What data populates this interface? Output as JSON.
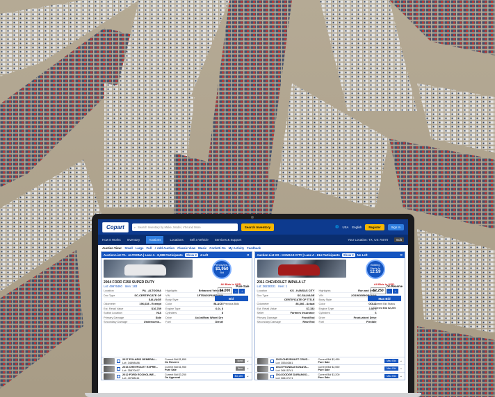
{
  "header": {
    "logo": "Copart",
    "search_placeholder": "Search Inventory by Make, Model, VIN and More",
    "search_button": "Search Inventory",
    "country": "USA",
    "language": "English",
    "register": "Register",
    "sign_in": "Sign In"
  },
  "nav": {
    "items": [
      "How It Works",
      "Inventory",
      "Auctions",
      "Locations",
      "Sell a Vehicle",
      "Services & Support"
    ],
    "active_index": 2,
    "location": "Your Location: TX, US 75070",
    "edit": "Edit"
  },
  "modes": {
    "label": "Auction View:",
    "items": [
      "Small",
      "Large",
      "Full",
      "+ Add Auction",
      "Classic View",
      "Music",
      "Confetti On",
      "My Activity",
      "Feedback"
    ]
  },
  "panel_left": {
    "title": "Auction List  PA - ALTOONA | Lane A - 8,388 Participants",
    "badge": "Show 2",
    "left_count": "4 Left",
    "vehicle": "2004 FORD F250 SUPER DUTY",
    "lot": "Lot: 49976460",
    "item": "Item: 183",
    "sale": "Pure Sale",
    "bid_circle_top": "Pennsylva...",
    "bid_circle_amount": "$1,950",
    "bid_circle_bottom": "Bid",
    "bids_note": "All Bids in USD.",
    "amount": "$4,000",
    "bid_button": "Bid",
    "prev_bids": "Previous Bids",
    "rows": [
      [
        "Location",
        "PA - ALTOONA",
        "Highlights",
        "Enhanced Vehicles"
      ],
      [
        "Doc Type",
        "SC-CERTIFICATE OF",
        "VIN",
        "1FTSW21P64ED*****"
      ],
      [
        "",
        "SALVAGE",
        "Body Style",
        "N/A"
      ],
      [
        "Odometer",
        "196,638 - Exempt",
        "Color",
        "BLACK"
      ],
      [
        "Est. Retail Value",
        "$16,789",
        "Engine Type",
        "6.0L 8"
      ],
      [
        "Sublot Location",
        "N/A",
        "Cylinders",
        "8"
      ],
      [
        "Primary Damage",
        "Side",
        "Drive",
        "4x4 w/Rear Wheel Drv"
      ],
      [
        "Secondary Damage",
        "Undercarria...",
        "Fuel",
        "Diesel"
      ]
    ],
    "list": [
      {
        "name": "2017 POLARIS GENERAL...",
        "lot": "Lot: 34898486",
        "status": "On Reserve",
        "bid": "Current Bid $1,850",
        "button": "Next"
      },
      {
        "name": "2016 CHEVROLET EXPRE...",
        "lot": "Lot: 35870497",
        "status": "Pure Sale",
        "bid": "Current Bid $1,950",
        "button": "Item"
      },
      {
        "name": "2012 FORD ECONOLINE...",
        "lot": "Lot: 40788411",
        "status": "On Approval",
        "bid": "Current Bid $3,250",
        "button": "$3,150"
      }
    ]
  },
  "panel_right": {
    "title": "Auction List  KS - KANSAS CITY | Lane A - 614 Participants",
    "badge": "Show 2",
    "left_count": "No Left",
    "vehicle": "2011 CHEVROLET IMPALA LT",
    "lot": "Lot: 36238331",
    "item": "Item: 1",
    "sale": "On Reserve",
    "bid_circle_top": "Bidding Starts In",
    "bid_circle_amount": "12:59",
    "bids_note": "All Bids in USD.",
    "amount": "$2,250",
    "bid_button": "Max Bid",
    "status_note": "Current Bid Status",
    "current_bid": "Current Bid $2,200",
    "rows": [
      [
        "Location",
        "KS - KANSAS CITY",
        "Highlights",
        "Run and Drive"
      ],
      [
        "Doc Type",
        "SC-SALVAGE",
        "VIN",
        "2G1WG5EK0B1*****"
      ],
      [
        "",
        "CERTIFICATE OF TITLE",
        "Body Style",
        "N/A"
      ],
      [
        "Odometer",
        "86,366 - Actual",
        "Color",
        "GOLD"
      ],
      [
        "Est. Retail Value",
        "$7,152",
        "Engine Type",
        "3.5L 6"
      ],
      [
        "Seller",
        "Farmers Insurance",
        "Cylinders",
        "6"
      ],
      [
        "Primary Damage",
        "Front End",
        "Drive",
        "Front-wheel Drive"
      ],
      [
        "Secondary Damage",
        "Rear End",
        "Fuel",
        "Flexible"
      ]
    ],
    "list": [
      {
        "name": "2015 CHEVROLET CRUZ...",
        "lot": "Lot: 35544361",
        "status": "Pure Sale",
        "bid": "Current Bid $2,450",
        "button": "Max Bid"
      },
      {
        "name": "2013 HYUNDAI SONATA...",
        "lot": "Lot: 36415741",
        "status": "Pure Sale",
        "bid": "Current Bid $2,550",
        "button": "Max Bid"
      },
      {
        "name": "2014 DODGE DURANGO...",
        "lot": "Lot: 36417171",
        "status": "Pure Sale",
        "bid": "Current Bid $3,200",
        "button": "Max Bid"
      }
    ]
  }
}
